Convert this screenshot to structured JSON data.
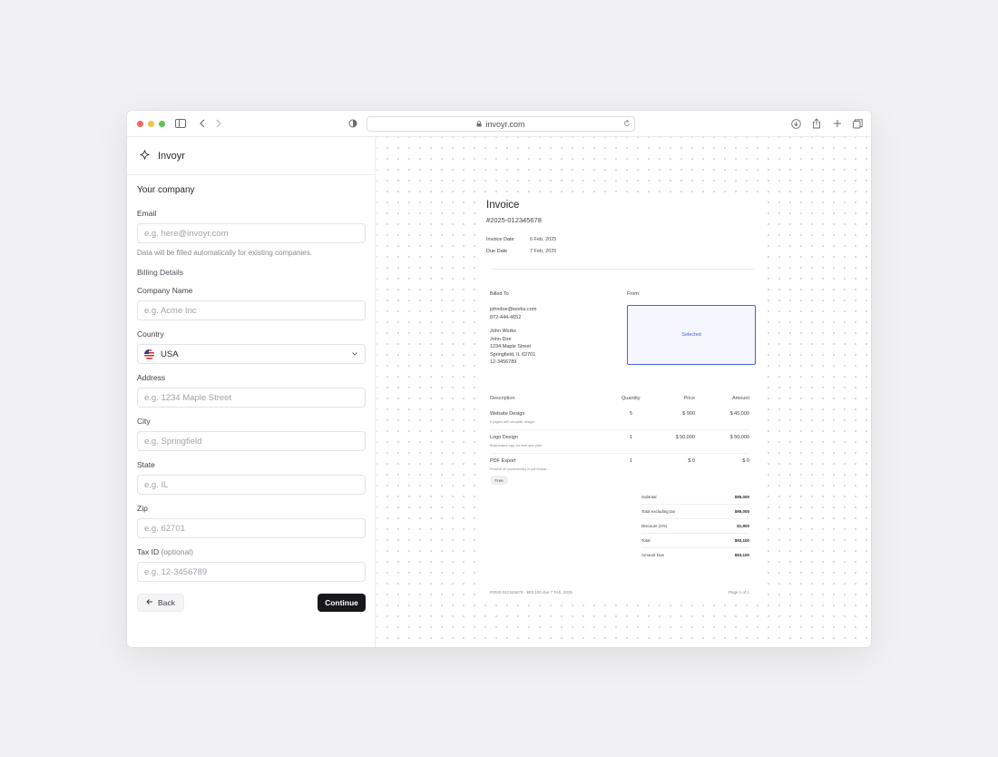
{
  "browser": {
    "url": "invoyr.com"
  },
  "brand": {
    "name": "Invoyr"
  },
  "form": {
    "section_title": "Your company",
    "email": {
      "label": "Email",
      "placeholder": "e.g. here@invoyr.com",
      "hint": "Data will be filled automatically for existing companies."
    },
    "billing_details_label": "Billing Details",
    "company_name": {
      "label": "Company Name",
      "placeholder": "e.g. Acme Inc"
    },
    "country": {
      "label": "Country",
      "value": "USA"
    },
    "address": {
      "label": "Address",
      "placeholder": "e.g. 1234 Maple Street"
    },
    "city": {
      "label": "City",
      "placeholder": "e.g. Springfield"
    },
    "state": {
      "label": "State",
      "placeholder": "e.g. IL"
    },
    "zip": {
      "label": "Zip",
      "placeholder": "e.g. 62701"
    },
    "tax_id": {
      "label": "Tax ID",
      "optional": "(optional)",
      "placeholder": "e.g. 12-3456789"
    },
    "back_label": "Back",
    "continue_label": "Continue"
  },
  "invoice": {
    "title": "Invoice",
    "number": "#2025-012345678",
    "invoice_date_label": "Invoice Date",
    "invoice_date": "6 Feb, 2025",
    "due_date_label": "Due Date",
    "due_date": "7 Feb, 2025",
    "billed_to_label": "Billed To",
    "from_label": "From",
    "billed_to": {
      "email": "johndoe@works.com",
      "phone": "872-444-4652",
      "company": "John Works",
      "name": "John Doe",
      "street": "1234 Maple Street",
      "city": "Springfield, IL 62701",
      "tax_id": "12-3456789"
    },
    "from_placeholder": "Selected",
    "columns": {
      "description": "Description",
      "quantity": "Quantity",
      "price": "Price",
      "amount": "Amount"
    },
    "items": [
      {
        "name": "Website Design",
        "note": "5 pages with versatile design",
        "quantity": "5",
        "price": "$ 900",
        "amount": "$ 45,000"
      },
      {
        "name": "Logo Design",
        "note": "Businesses logo for web and print",
        "quantity": "1",
        "price": "$ 50,000",
        "amount": "$ 50,000"
      },
      {
        "name": "PDF Export",
        "note": "Present all document(s) in pdf format",
        "quantity": "1",
        "price": "$ 0",
        "amount": "$ 0",
        "badge": "Free"
      }
    ],
    "totals": [
      {
        "label": "Subtotal",
        "value": "$95,000"
      },
      {
        "label": "Total excluding tax",
        "value": "$95,000"
      },
      {
        "label": "Discount (2%)",
        "value": "$1,900"
      },
      {
        "label": "Total",
        "value": "$93,100"
      },
      {
        "label": "Amount Due",
        "value": "$93,100"
      }
    ],
    "footer_left": "#2025-012345678 · $93,100 due 7 Feb, 2025",
    "footer_right": "Page 1 of 1"
  }
}
